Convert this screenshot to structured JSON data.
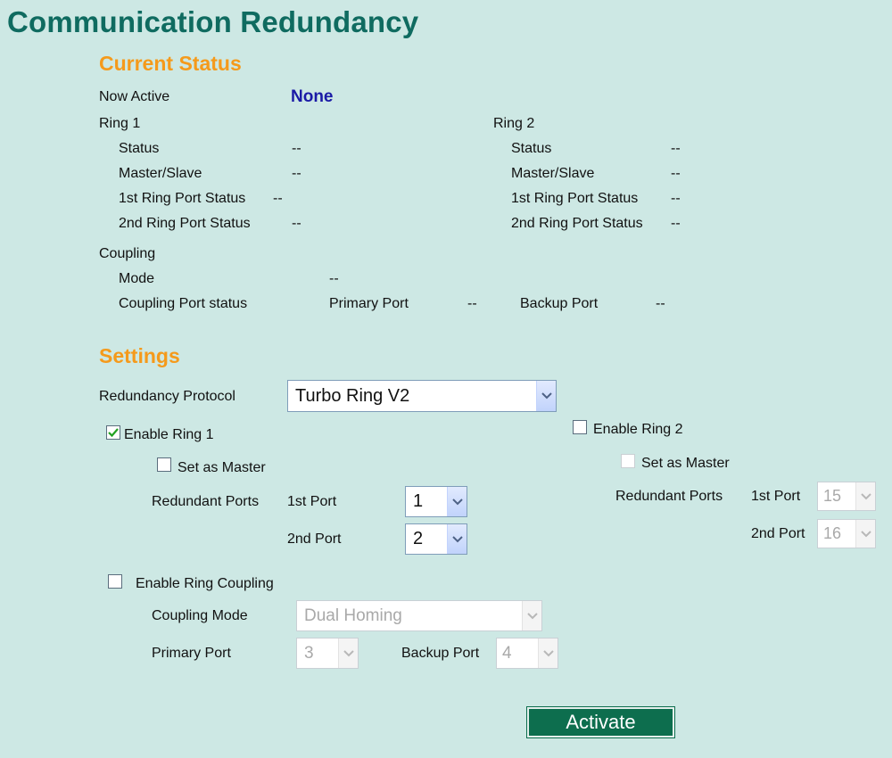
{
  "title": "Communication Redundancy",
  "current_status": {
    "heading": "Current Status",
    "now_active_label": "Now Active",
    "now_active_value": "None",
    "ring1": {
      "heading": "Ring 1",
      "status_label": "Status",
      "status_value": "--",
      "master_label": "Master/Slave",
      "master_value": "--",
      "port1_label": "1st Ring Port Status",
      "port1_value": "--",
      "port2_label": "2nd Ring Port Status",
      "port2_value": "--"
    },
    "ring2": {
      "heading": "Ring 2",
      "status_label": "Status",
      "status_value": "--",
      "master_label": "Master/Slave",
      "master_value": "--",
      "port1_label": "1st Ring Port Status",
      "port1_value": "--",
      "port2_label": "2nd Ring Port Status",
      "port2_value": "--"
    },
    "coupling": {
      "heading": "Coupling",
      "mode_label": "Mode",
      "mode_value": "--",
      "port_status_label": "Coupling Port status",
      "primary_label": "Primary Port",
      "primary_value": "--",
      "backup_label": "Backup Port",
      "backup_value": "--"
    }
  },
  "settings": {
    "heading": "Settings",
    "protocol_label": "Redundancy Protocol",
    "protocol_value": "Turbo Ring V2",
    "ring1": {
      "enable_label": "Enable Ring 1",
      "enabled": true,
      "master_label": "Set as Master",
      "master": false,
      "redundant_ports_label": "Redundant Ports",
      "port1_label": "1st Port",
      "port1_value": "1",
      "port2_label": "2nd Port",
      "port2_value": "2"
    },
    "ring2": {
      "enable_label": "Enable Ring 2",
      "enabled": false,
      "master_label": "Set as Master",
      "master": false,
      "redundant_ports_label": "Redundant Ports",
      "port1_label": "1st Port",
      "port1_value": "15",
      "port2_label": "2nd Port",
      "port2_value": "16"
    },
    "coupling": {
      "enable_label": "Enable Ring Coupling",
      "enabled": false,
      "mode_label": "Coupling Mode",
      "mode_value": "Dual Homing",
      "primary_label": "Primary Port",
      "primary_value": "3",
      "backup_label": "Backup Port",
      "backup_value": "4"
    }
  },
  "activate_label": "Activate",
  "colors": {
    "background": "#cde8e4",
    "title": "#0f6b60",
    "section_heading": "#f59a1b",
    "now_active_value": "#1a1aa6",
    "activate_button": "#0d6e4e"
  }
}
